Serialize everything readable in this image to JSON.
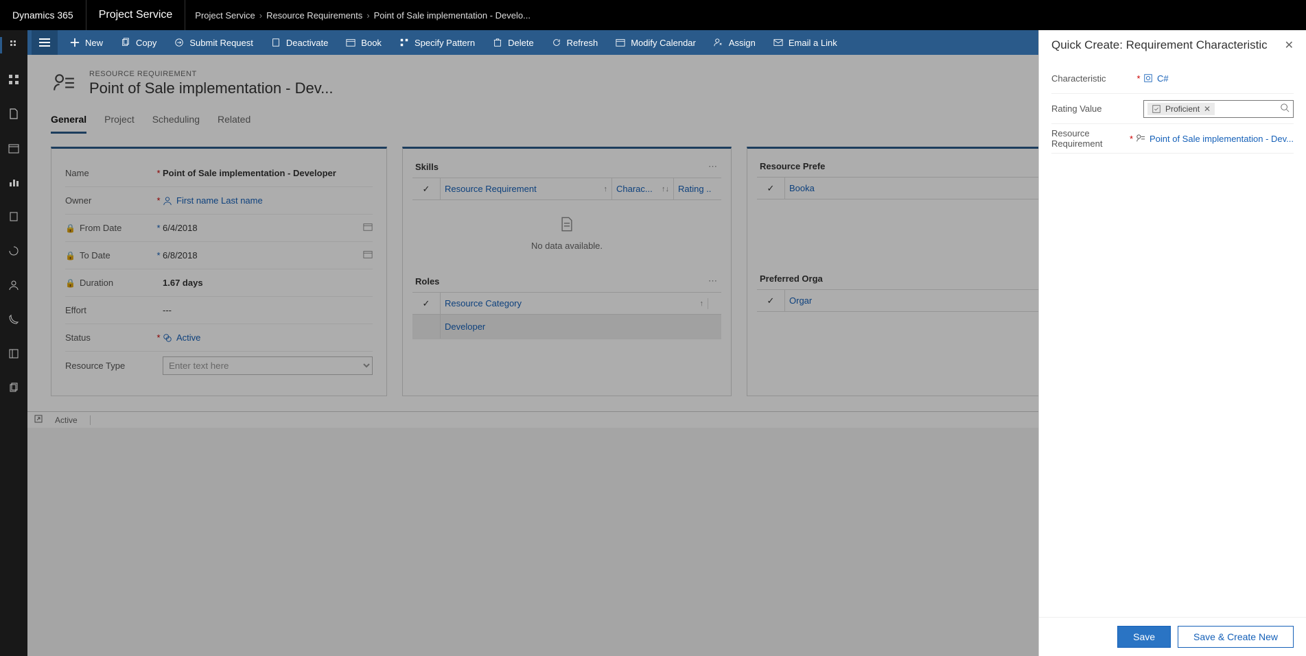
{
  "brand": "Dynamics 365",
  "app_name": "Project Service",
  "breadcrumb": {
    "a": "Project Service",
    "b": "Resource Requirements",
    "c": "Point of Sale implementation - Develo..."
  },
  "commands": {
    "new": "New",
    "copy": "Copy",
    "submit": "Submit Request",
    "deactivate": "Deactivate",
    "book": "Book",
    "specify": "Specify Pattern",
    "delete": "Delete",
    "refresh": "Refresh",
    "modcal": "Modify Calendar",
    "assign": "Assign",
    "email": "Email a Link"
  },
  "record": {
    "type_label": "RESOURCE REQUIREMENT",
    "title": "Point of Sale implementation - Dev..."
  },
  "tabs": {
    "general": "General",
    "project": "Project",
    "scheduling": "Scheduling",
    "related": "Related"
  },
  "general": {
    "name_lbl": "Name",
    "name_val": "Point of Sale implementation - Developer",
    "owner_lbl": "Owner",
    "owner_val": "First name Last name",
    "from_lbl": "From Date",
    "from_val": "6/4/2018",
    "to_lbl": "To Date",
    "to_val": "6/8/2018",
    "duration_lbl": "Duration",
    "duration_val": "1.67 days",
    "effort_lbl": "Effort",
    "effort_val": "---",
    "status_lbl": "Status",
    "status_val": "Active",
    "restype_lbl": "Resource Type",
    "restype_ph": "Enter text here"
  },
  "skills": {
    "title": "Skills",
    "col_req": "Resource Requirement",
    "col_ch": "Charac...",
    "col_rat": "Rating ..",
    "empty": "No data available."
  },
  "roles": {
    "title": "Roles",
    "col_cat": "Resource Category",
    "row0": "Developer"
  },
  "resprefs": {
    "title": "Resource Prefe",
    "col_book": "Booka"
  },
  "preforg": {
    "title": "Preferred Orga",
    "col_org": "Orgar"
  },
  "statusbar": {
    "status": "Active"
  },
  "qc": {
    "title": "Quick Create: Requirement Characteristic",
    "char_lbl": "Characteristic",
    "char_val": "C#",
    "rating_lbl": "Rating Value",
    "rating_val": "Proficient",
    "req_lbl": "Resource Requirement",
    "req_val": "Point of Sale implementation - Dev...",
    "save": "Save",
    "savecreate": "Save & Create New"
  }
}
